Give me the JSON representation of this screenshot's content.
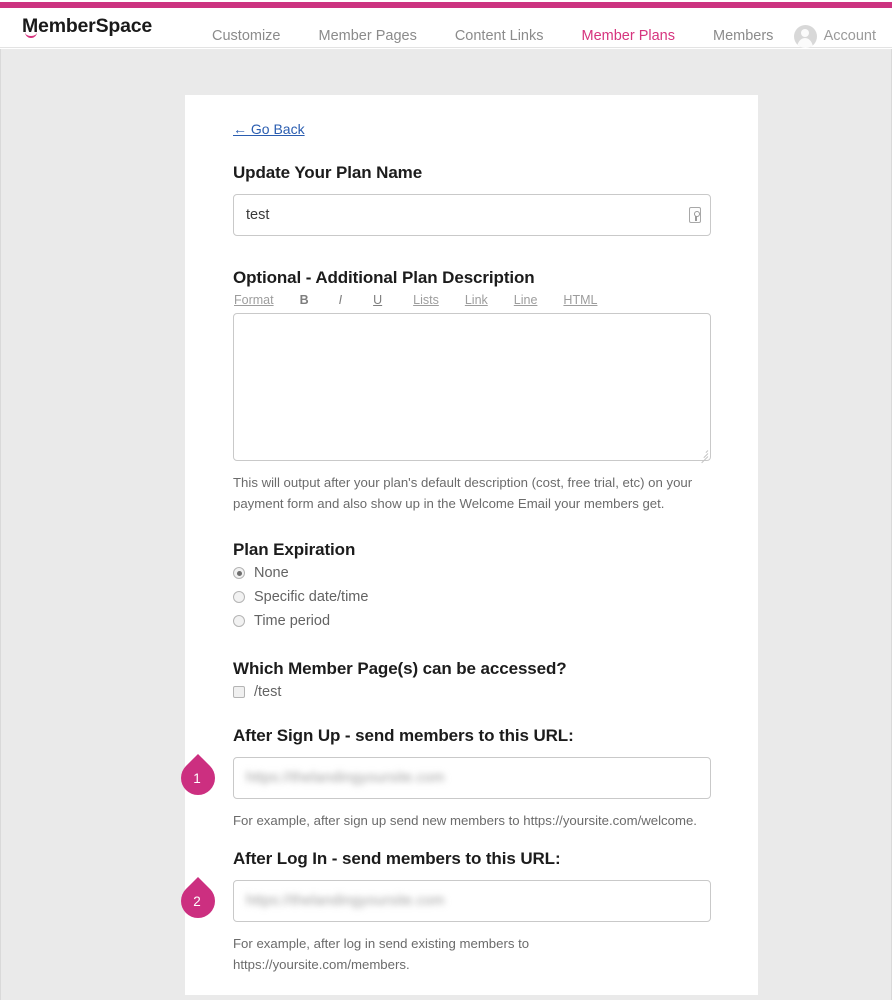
{
  "header": {
    "logo": "MemberSpace",
    "nav": [
      {
        "label": "Customize",
        "active": false
      },
      {
        "label": "Member Pages",
        "active": false
      },
      {
        "label": "Content Links",
        "active": false
      },
      {
        "label": "Member Plans",
        "active": true
      },
      {
        "label": "Members",
        "active": false
      }
    ],
    "account_label": "Account",
    "accent_color": "#cc3380",
    "active_nav_color": "#d6347e"
  },
  "main": {
    "go_back": "←  Go Back",
    "plan_name": {
      "title": "Update Your Plan Name",
      "value": "test"
    },
    "description": {
      "title": "Optional - Additional Plan Description",
      "toolbar": [
        "Format",
        "B",
        "I",
        "U",
        "Lists",
        "Link",
        "Line",
        "HTML"
      ],
      "value": "",
      "help": "This will output after your plan's default description (cost, free trial, etc) on your payment form and also show up in the Welcome Email your members get."
    },
    "expiration": {
      "title": "Plan Expiration",
      "options": [
        {
          "label": "None",
          "checked": true
        },
        {
          "label": "Specific date/time",
          "checked": false
        },
        {
          "label": "Time period",
          "checked": false
        }
      ]
    },
    "member_pages": {
      "title": "Which Member Page(s) can be accessed?",
      "options": [
        {
          "label": "/test",
          "checked": false
        }
      ]
    },
    "after_signup": {
      "title": "After Sign Up - send members to this URL:",
      "placeholder": "https://thelandingyoursite.com",
      "value": "",
      "help": "For example, after sign up send new members to https://yoursite.com/welcome.",
      "callout": "1"
    },
    "after_login": {
      "title": "After Log In - send members to this URL:",
      "placeholder": "https://thelandingyoursite.com",
      "value": "",
      "help": "For example, after log in send existing members to https://yoursite.com/members.",
      "callout": "2"
    }
  }
}
